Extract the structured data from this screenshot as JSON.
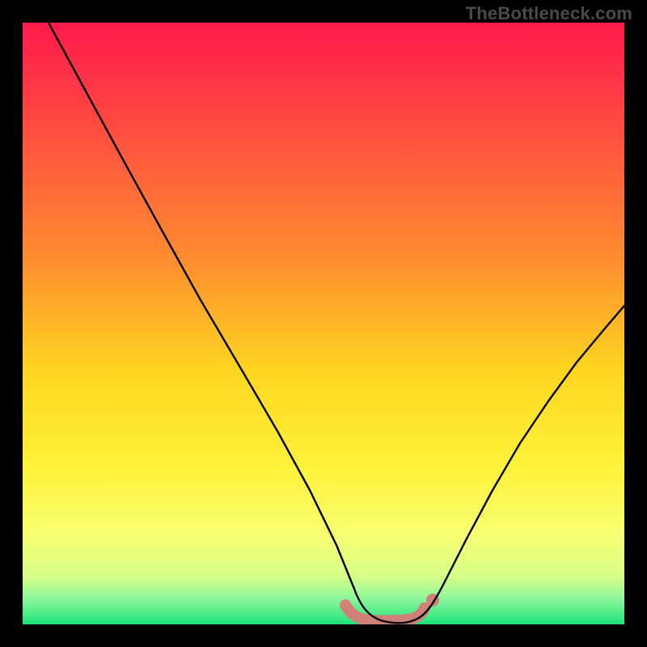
{
  "watermark": "TheBottleneck.com",
  "colors": {
    "background": "#000000",
    "curve": "#000000",
    "marker": "#d87a77",
    "gradient_top": "#ff1a4b",
    "gradient_bottom": "#1de37a"
  },
  "chart_data": {
    "type": "line",
    "title": "",
    "xlabel": "",
    "ylabel": "",
    "xlim": [
      0,
      100
    ],
    "ylim": [
      0,
      100
    ],
    "x": [
      0,
      5,
      10,
      15,
      20,
      25,
      30,
      35,
      40,
      45,
      50,
      55,
      58,
      60,
      62,
      65,
      70,
      75,
      80,
      85,
      90,
      95,
      100
    ],
    "values": [
      100,
      91,
      82,
      73,
      64,
      55,
      46,
      37,
      28,
      19,
      11,
      4,
      1,
      0,
      0,
      1,
      5,
      12,
      22,
      32,
      42,
      50,
      58
    ],
    "highlight_range_x": [
      54,
      66
    ],
    "notes": "V-shaped bottleneck curve on a vertical red-to-green gradient. Minimum (≈0) near x≈60. Pink marker band highlights the flat bottom region roughly x=54–66. Axes unlabeled; values estimated from pixel geometry."
  }
}
